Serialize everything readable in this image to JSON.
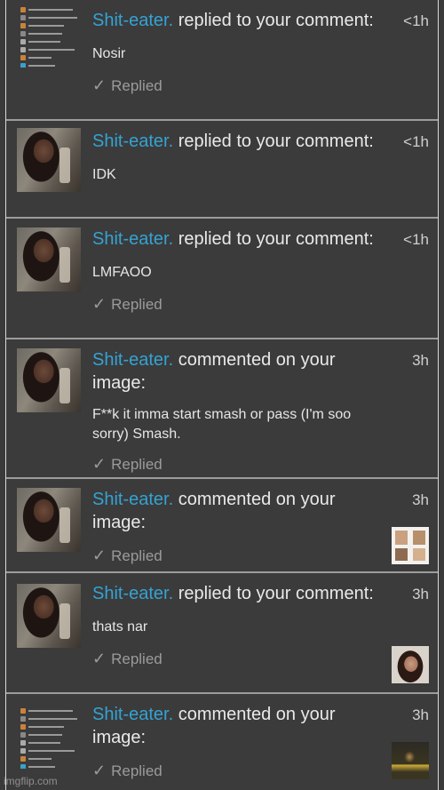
{
  "notifications": [
    {
      "user": "Shit-eater.",
      "action": " replied to your comment:",
      "text": "Nosir",
      "replied": "Replied",
      "time": "<1h"
    },
    {
      "user": "Shit-eater.",
      "action": " replied to your comment:",
      "text": "IDK",
      "replied": "",
      "time": "<1h"
    },
    {
      "user": "Shit-eater.",
      "action": " replied to your comment:",
      "text": "LMFAOO",
      "replied": "Replied",
      "time": "<1h"
    },
    {
      "user": "Shit-eater.",
      "action": " commented on your image:",
      "text": "F**k it imma start smash or pass (I'm soo sorry) Smash.",
      "replied": "Replied",
      "time": "3h"
    },
    {
      "user": "Shit-eater.",
      "action": " commented on your image:",
      "text": "",
      "replied": "Replied",
      "time": "3h"
    },
    {
      "user": "Shit-eater.",
      "action": " replied to your comment:",
      "text": "thats nar",
      "replied": "Replied",
      "time": "3h"
    },
    {
      "user": "Shit-eater.",
      "action": " commented on your image:",
      "text": "",
      "replied": "Replied",
      "time": "3h"
    }
  ],
  "check_glyph": "✓",
  "watermark": "imgflip.com"
}
